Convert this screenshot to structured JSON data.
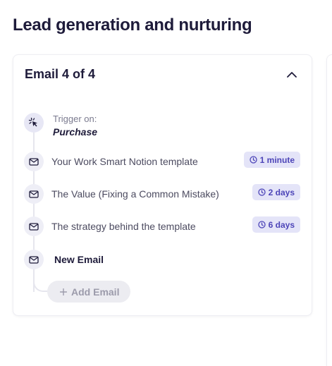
{
  "page": {
    "title": "Lead generation and nurturing"
  },
  "sequence": {
    "title": "Email 4 of 4",
    "trigger": {
      "label": "Trigger on:",
      "value": "Purchase"
    },
    "emails": [
      {
        "subject": "Your Work Smart Notion template",
        "delay": "1 minute"
      },
      {
        "subject": "The Value (Fixing a Common Mistake)",
        "delay": "2 days"
      },
      {
        "subject": "The strategy behind the template",
        "delay": "6 days"
      }
    ],
    "new_email_label": "New Email",
    "add_email_label": "Add Email"
  },
  "colors": {
    "badge_bg": "#e4e4f8",
    "badge_text": "#4d45b8",
    "heading": "#1e1b3a"
  },
  "icons": {
    "trigger": "cursor-click-icon",
    "email": "mail-icon",
    "delay": "clock-icon",
    "collapse": "chevron-up-icon",
    "add": "plus-icon"
  }
}
